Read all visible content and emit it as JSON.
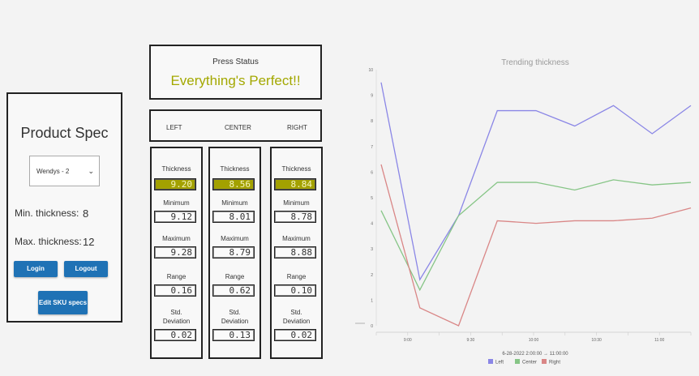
{
  "product_spec": {
    "title": "Product Spec",
    "sku_selected": "Wendys - 2",
    "min_label": "Min. thickness:",
    "min_value": "8",
    "max_label": "Max. thickness:",
    "max_value": "12",
    "login_label": "Login",
    "logout_label": "Logout",
    "edit_label": "Edit SKU specs"
  },
  "press_status": {
    "label": "Press Status",
    "text": "Everything's Perfect!!",
    "text_color": "#a3a800"
  },
  "columns_header": {
    "left": "LEFT",
    "center": "CENTER",
    "right": "RIGHT"
  },
  "metrics": {
    "labels": {
      "thickness": "Thickness",
      "minimum": "Minimum",
      "maximum": "Maximum",
      "range": "Range",
      "std_line1": "Std.",
      "std_line2": "Deviation"
    },
    "left": {
      "thickness": "9.20",
      "minimum": "9.12",
      "maximum": "9.28",
      "range": "0.16",
      "std": "0.02"
    },
    "center": {
      "thickness": "8.56",
      "minimum": "8.01",
      "maximum": "8.79",
      "range": "0.62",
      "std": "0.13"
    },
    "right": {
      "thickness": "8.84",
      "minimum": "8.78",
      "maximum": "8.88",
      "range": "0.10",
      "std": "0.02"
    },
    "highlight_color": "#a3a100"
  },
  "chart_data": {
    "type": "line",
    "title": "Trending thickness",
    "ylim": [
      0,
      10
    ],
    "y_ticks": [
      "0",
      "1",
      "2",
      "3",
      "4",
      "5",
      "6",
      "7",
      "8",
      "9",
      "10"
    ],
    "x_ticks": [
      "9:00",
      "9:30",
      "10:00",
      "10:30",
      "11:00",
      "11:30",
      "12:00",
      "12:30",
      "13:00",
      "13:30",
      "14:00"
    ],
    "x_tick_labels_visible": [
      "",
      "9:00",
      "",
      "9:30",
      "",
      "10:00",
      "",
      "10:30",
      "",
      "11:00",
      ""
    ],
    "grid": false,
    "legend_position": "bottom",
    "caption": "6-28-2022   2:00:00  →   11:00:00",
    "series": [
      {
        "name": "Left",
        "color": "#8a86e6",
        "values": [
          9.5,
          1.8,
          4.3,
          8.4,
          8.4,
          7.8,
          8.6,
          7.5,
          8.6
        ]
      },
      {
        "name": "Center",
        "color": "#86c586",
        "values": [
          4.5,
          1.4,
          4.3,
          5.6,
          5.6,
          5.3,
          5.7,
          5.5,
          5.6
        ]
      },
      {
        "name": "Right",
        "color": "#d98686",
        "values": [
          6.3,
          0.7,
          0.0,
          4.1,
          4.0,
          4.1,
          4.1,
          4.2,
          4.6
        ]
      }
    ]
  }
}
